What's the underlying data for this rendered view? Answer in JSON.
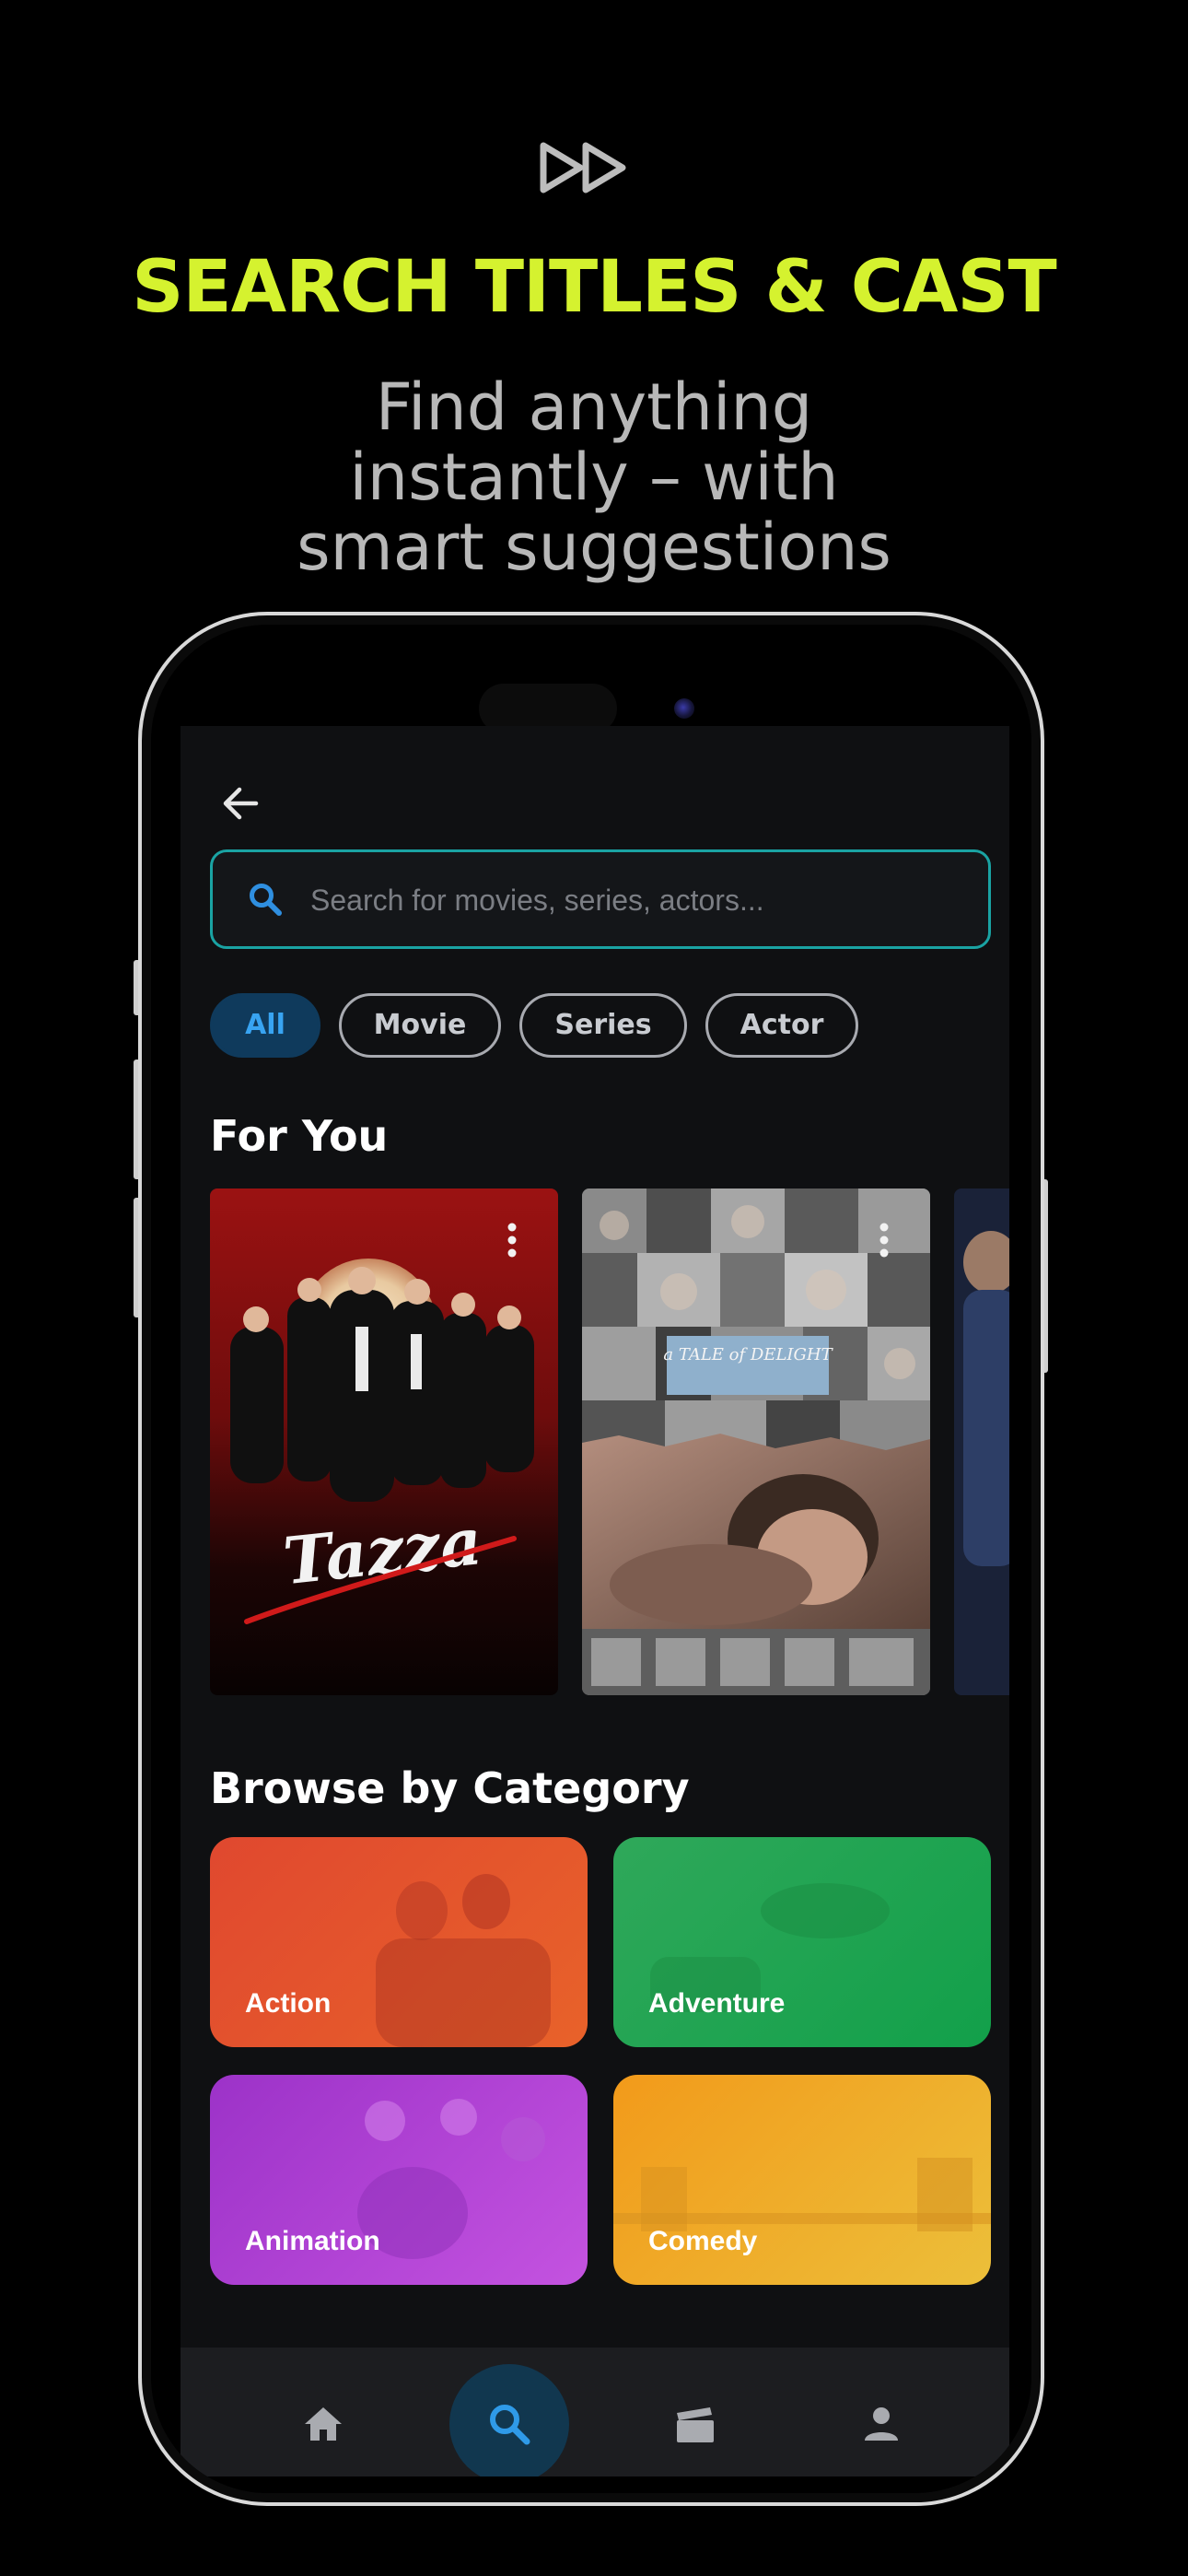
{
  "promo": {
    "headline": "SEARCH TITLES & CAST",
    "subhead_line1": "Find anything",
    "subhead_line2": "instantly – with",
    "subhead_line3": "smart suggestions"
  },
  "search": {
    "placeholder": "Search for movies, series, actors..."
  },
  "filters": {
    "chips": [
      "All",
      "Movie",
      "Series",
      "Actor"
    ],
    "selected": "All"
  },
  "for_you": {
    "title": "For You",
    "posters": [
      {
        "title_art": "Tazza"
      },
      {
        "title_art": "a TALE of DELIGHT"
      },
      {
        "title_art": ""
      }
    ]
  },
  "categories": {
    "title": "Browse by Category",
    "items": [
      {
        "label": "Action",
        "color": "#e0482f"
      },
      {
        "label": "Adventure",
        "color": "#1fa64e"
      },
      {
        "label": "Animation",
        "color": "#a43ad0"
      },
      {
        "label": "Comedy",
        "color": "#f0a82a"
      }
    ]
  },
  "bottom_nav": {
    "items": [
      "home-icon",
      "search-icon",
      "clapperboard-icon",
      "person-icon"
    ],
    "active": "search-icon"
  },
  "colors": {
    "accent_lime": "#d5f22f",
    "search_border": "#1aa3a3",
    "chip_active_bg": "#0f3a5c",
    "chip_active_text": "#38a4f2"
  }
}
